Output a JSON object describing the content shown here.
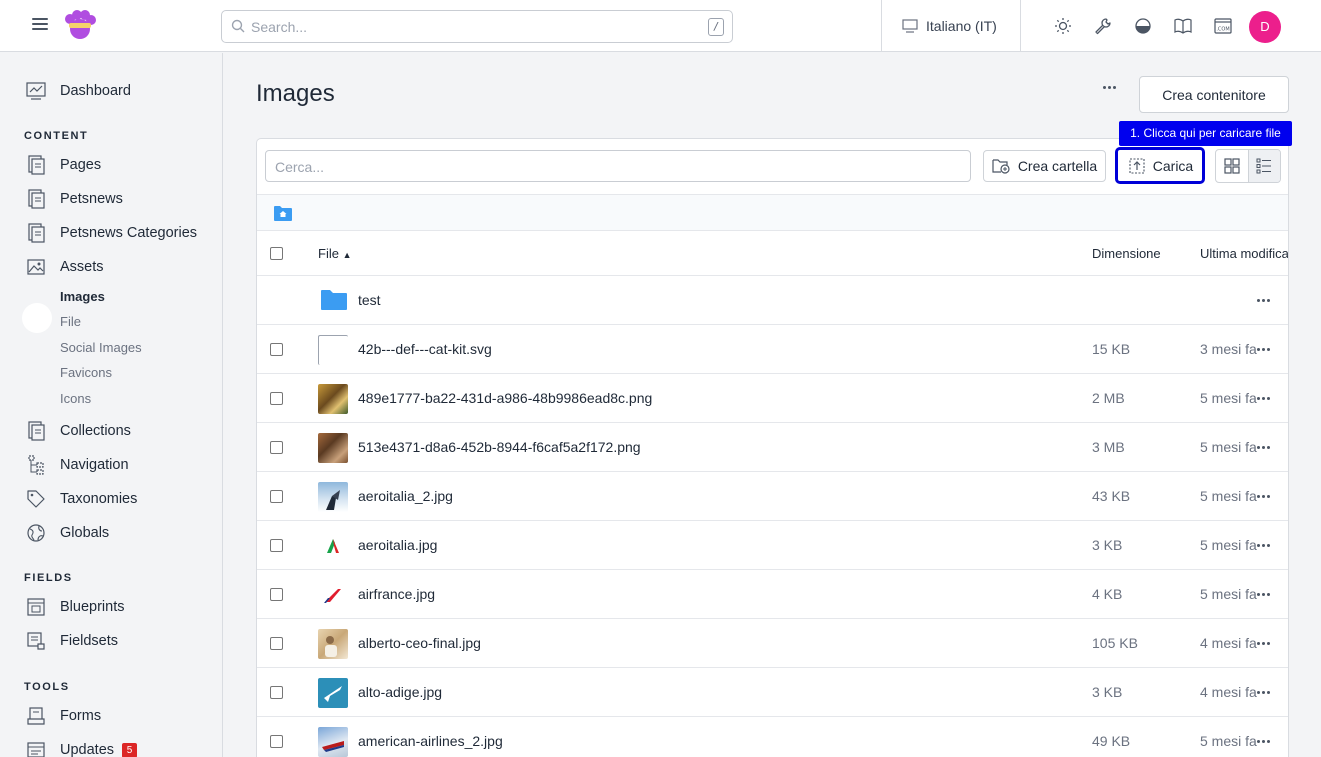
{
  "topbar": {
    "search_placeholder": "Search...",
    "search_shortcut": "/",
    "site_label": "Italiano (IT)",
    "user_initial": "D",
    "icons": [
      "menu-icon",
      "logo",
      "search-icon",
      "site-icon",
      "sun-icon",
      "wrench-icon",
      "contrast-icon",
      "book-icon",
      "domain-icon"
    ]
  },
  "sidebar": {
    "dashboard": "Dashboard",
    "content_heading": "CONTENT",
    "content": [
      "Pages",
      "Petsnews",
      "Petsnews Categories",
      "Assets"
    ],
    "asset_subs": [
      "Images",
      "File",
      "Social Images",
      "Favicons",
      "Icons"
    ],
    "content_more": [
      "Collections",
      "Navigation",
      "Taxonomies",
      "Globals"
    ],
    "fields_heading": "FIELDS",
    "fields": [
      "Blueprints",
      "Fieldsets"
    ],
    "tools_heading": "TOOLS",
    "tools": [
      "Forms",
      "Updates"
    ],
    "updates_badge": "5"
  },
  "main": {
    "title": "Images",
    "create_container": "Crea contenitore",
    "filter_placeholder": "Cerca...",
    "create_folder": "Crea cartella",
    "upload": "Carica",
    "tooltip": "1. Clicca qui per caricare file",
    "columns": {
      "file": "File",
      "size": "Dimensione",
      "modified": "Ultima modifica"
    },
    "folder": "test",
    "files": [
      {
        "name": "42b---def---cat-kit.svg",
        "size": "15 KB",
        "modified": "3 mesi fa"
      },
      {
        "name": "489e1777-ba22-431d-a986-48b9986ead8c.png",
        "size": "2 MB",
        "modified": "5 mesi fa"
      },
      {
        "name": "513e4371-d8a6-452b-8944-f6caf5a2f172.png",
        "size": "3 MB",
        "modified": "5 mesi fa"
      },
      {
        "name": "aeroitalia_2.jpg",
        "size": "43 KB",
        "modified": "5 mesi fa"
      },
      {
        "name": "aeroitalia.jpg",
        "size": "3 KB",
        "modified": "5 mesi fa"
      },
      {
        "name": "airfrance.jpg",
        "size": "4 KB",
        "modified": "5 mesi fa"
      },
      {
        "name": "alberto-ceo-final.jpg",
        "size": "105 KB",
        "modified": "4 mesi fa"
      },
      {
        "name": "alto-adige.jpg",
        "size": "3 KB",
        "modified": "4 mesi fa"
      },
      {
        "name": "american-airlines_2.jpg",
        "size": "49 KB",
        "modified": "5 mesi fa"
      }
    ]
  },
  "colors": {
    "accent": "#0000ee",
    "avatar": "#ec1f8c",
    "folder": "#3b9cf2",
    "badge": "#dc2626"
  }
}
